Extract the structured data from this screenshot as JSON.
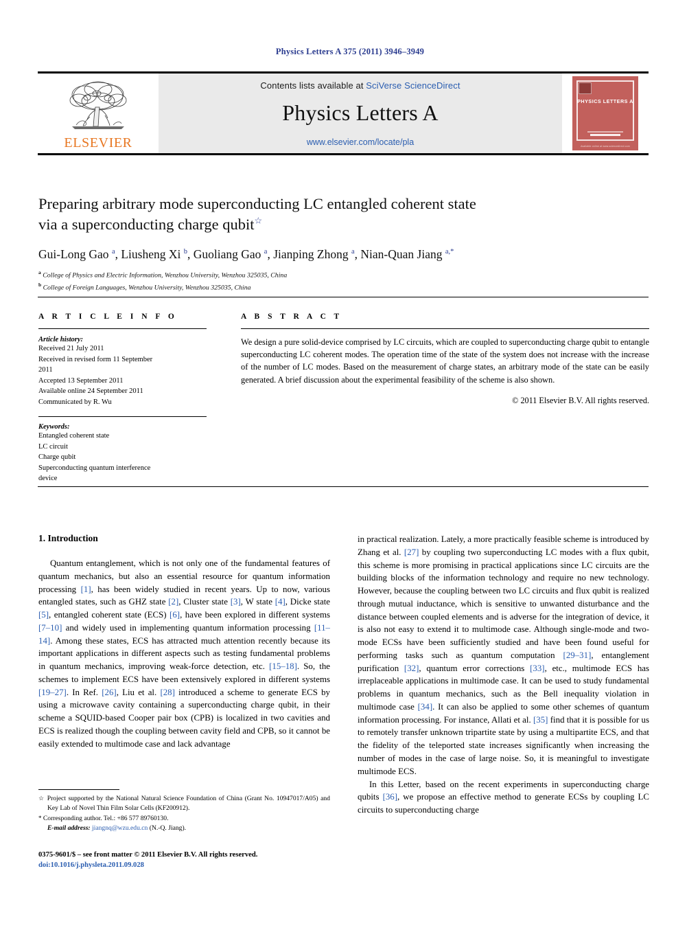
{
  "running_head": "Physics Letters A 375 (2011) 3946–3949",
  "masthead": {
    "publisher_name": "ELSEVIER",
    "contents_prefix": "Contents lists available at ",
    "sciencedirect_link": "SciVerse ScienceDirect",
    "journal_title": "Physics Letters A",
    "journal_url": "www.elsevier.com/locate/pla",
    "cover_title": "PHYSICS LETTERS A",
    "cover_bottom_text": "Available online at www.sciencedirect.com",
    "cover_color": "#c2605c",
    "elsevier_orange": "#E87722",
    "link_blue": "#2a5db0"
  },
  "article": {
    "title_line1": "Preparing arbitrary mode superconducting LC entangled coherent state",
    "title_line2": "via a superconducting charge qubit",
    "title_footnote_marker": "☆",
    "authors": "Gui-Long Gao a, Liusheng Xi b, Guoliang Gao a, Jianping Zhong a, Nian-Quan Jiang a,*",
    "affiliation_a_marker": "a",
    "affiliation_a": "College of Physics and Electric Information, Wenzhou University, Wenzhou 325035, China",
    "affiliation_b_marker": "b",
    "affiliation_b": "College of Foreign Languages, Wenzhou University, Wenzhou 325035, China"
  },
  "article_info": {
    "heading": "A R T I C L E   I N F O",
    "history_label": "Article history:",
    "history": [
      "Received 21 July 2011",
      "Received in revised form 11 September",
      "2011",
      "Accepted 13 September 2011",
      "Available online 24 September 2011",
      "Communicated by R. Wu"
    ],
    "keywords_label": "Keywords:",
    "keywords": [
      "Entangled coherent state",
      "LC circuit",
      "Charge qubit",
      "Superconducting quantum interference",
      "device"
    ]
  },
  "abstract": {
    "heading": "A B S T R A C T",
    "text": "We design a pure solid-device comprised by LC circuits, which are coupled to superconducting charge qubit to entangle superconducting LC coherent modes. The operation time of the state of the system does not increase with the increase of the number of LC modes. Based on the measurement of charge states, an arbitrary mode of the state can be easily generated. A brief discussion about the experimental feasibility of the scheme is also shown.",
    "copyright": "© 2011 Elsevier B.V. All rights reserved."
  },
  "body": {
    "section_title": "1. Introduction",
    "left_paragraph_part1": "Quantum entanglement, which is not only one of the fundamental features of quantum mechanics, but also an essential resource for quantum information processing ",
    "left_ref1": "[1]",
    "left_part2": ", has been widely studied in recent years. Up to now, various entangled states, such as GHZ state ",
    "left_ref2": "[2]",
    "left_part3": ", Cluster state ",
    "left_ref3": "[3]",
    "left_part4": ", W state ",
    "left_ref4": "[4]",
    "left_part5": ", Dicke state ",
    "left_ref5": "[5]",
    "left_part6": ", entangled coherent state (ECS) ",
    "left_ref6": "[6]",
    "left_part7": ", have been explored in different systems ",
    "left_ref7": "[7–10]",
    "left_part8": " and widely used in implementing quantum information processing ",
    "left_ref8": "[11–14]",
    "left_part9": ". Among these states, ECS has attracted much attention recently because its important applications in different aspects such as testing fundamental problems in quantum mechanics, improving weak-force detection, etc. ",
    "left_ref9": "[15–18]",
    "left_part10": ". So, the schemes to implement ECS have been extensively explored in different systems ",
    "left_ref10": "[19–27]",
    "left_part11": ". In Ref. ",
    "left_ref11": "[26]",
    "left_part12": ", Liu et al. ",
    "left_ref12": "[28]",
    "left_part13": " introduced a scheme to generate ECS by using a microwave cavity containing a superconducting charge qubit, in their scheme a SQUID-based Cooper pair box (CPB) is localized in two cavities and ECS is realized though the coupling between cavity field and CPB, so it cannot be easily extended to multimode case and lack advantage",
    "right_part1": "in practical realization. Lately, a more practically feasible scheme is introduced by Zhang et al. ",
    "right_ref1": "[27]",
    "right_part2": " by coupling two superconducting LC modes with a flux qubit, this scheme is more promising in practical applications since LC circuits are the building blocks of the information technology and require no new technology. However, because the coupling between two LC circuits and flux qubit is realized through mutual inductance, which is sensitive to unwanted disturbance and the distance between coupled elements and is adverse for the integration of device, it is also not easy to extend it to multimode case. Although single-mode and two-mode ECSs have been sufficiently studied and have been found useful for performing tasks such as quantum computation ",
    "right_ref2": "[29–31]",
    "right_part3": ", entanglement purification ",
    "right_ref3": "[32]",
    "right_part4": ", quantum error corrections ",
    "right_ref4": "[33]",
    "right_part5": ", etc., multimode ECS has irreplaceable applications in multimode case. It can be used to study fundamental problems in quantum mechanics, such as the Bell inequality violation in multimode case ",
    "right_ref5": "[34]",
    "right_part6": ". It can also be applied to some other schemes of quantum information processing. For instance, Allati et al. ",
    "right_ref6": "[35]",
    "right_part7": " find that it is possible for us to remotely transfer unknown tripartite state by using a multipartite ECS, and that the fidelity of the teleported state increases significantly when increasing the number of modes in the case of large noise. So, it is meaningful to investigate multimode ECS.",
    "right_para2_part1": "In this Letter, based on the recent experiments in superconducting charge qubits ",
    "right_para2_ref1": "[36]",
    "right_para2_part2": ", we propose an effective method to generate ECSs by coupling LC circuits to superconducting charge"
  },
  "footnote": {
    "star_marker": "☆",
    "grant_text": "Project supported by the National Natural Science Foundation of China (Grant No. 10947017/A05) and Key Lab of Novel Thin Film Solar Cells (KF200912).",
    "corr_marker": "*",
    "corr_text": "Corresponding author. Tel.: +86 577 89760130.",
    "email_label": "E-mail address:",
    "email": "jiangnq@wzu.edu.cn",
    "email_suffix": "(N.-Q. Jiang)."
  },
  "imprint": {
    "line1": "0375-9601/$ – see front matter © 2011 Elsevier B.V. All rights reserved.",
    "doi": "doi:10.1016/j.physleta.2011.09.028"
  }
}
